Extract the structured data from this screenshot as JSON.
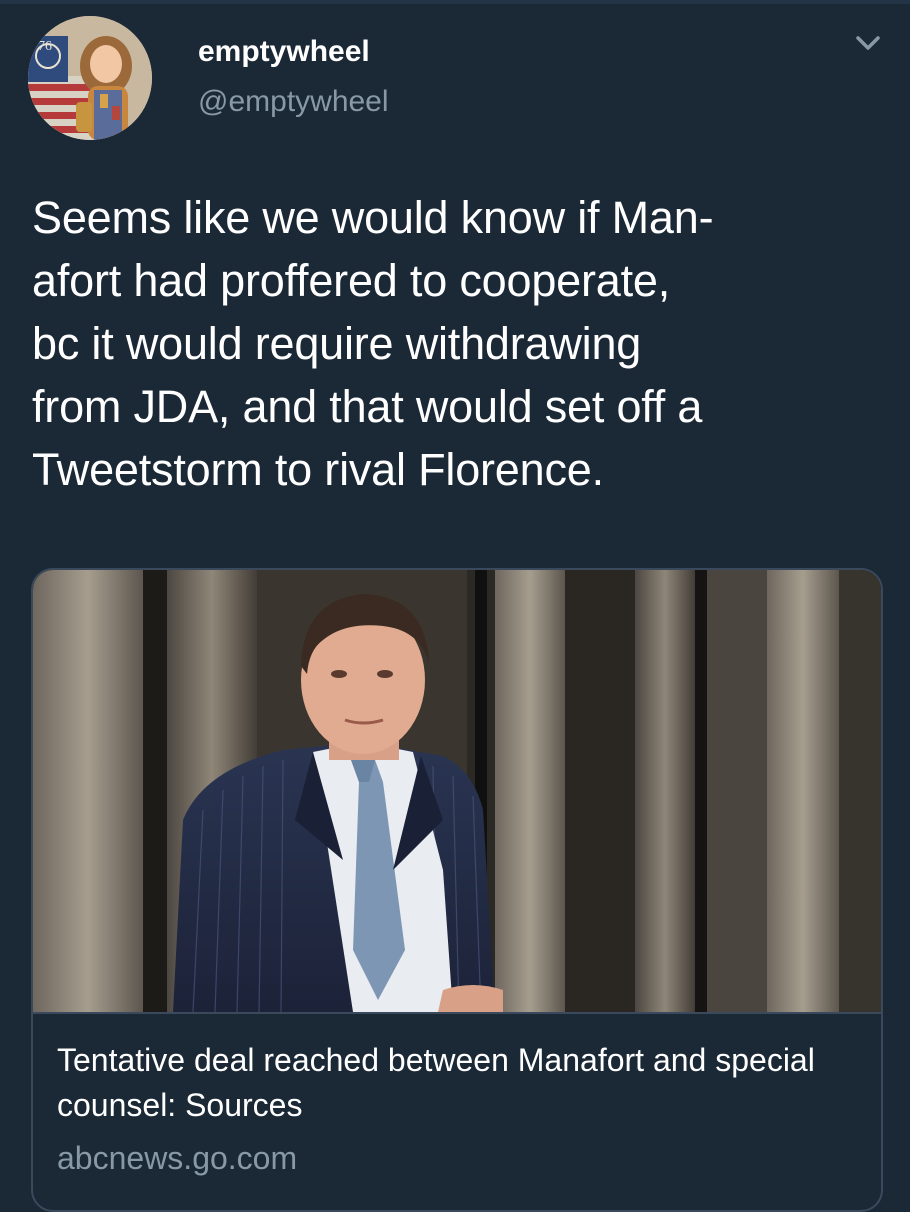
{
  "tweet": {
    "author": {
      "display_name": "emptywheel",
      "handle": "@emptywheel",
      "avatar_icon": "profile-photo"
    },
    "menu_icon": "chevron-down-icon",
    "text": "Seems like we would know if Man-\nafort had proffered to cooperate,\nbc it would require withdrawing\nfrom JDA, and that would set off a\nTweetstorm to rival Florence."
  },
  "card": {
    "title": "Tentative deal reached between Manafort and special counsel: Sources",
    "domain": "abcnews.go.com",
    "image_icon": "news-photo"
  },
  "colors": {
    "background": "#1b2836",
    "secondary_text": "#8899a6",
    "card_border": "#3a4a5c"
  }
}
